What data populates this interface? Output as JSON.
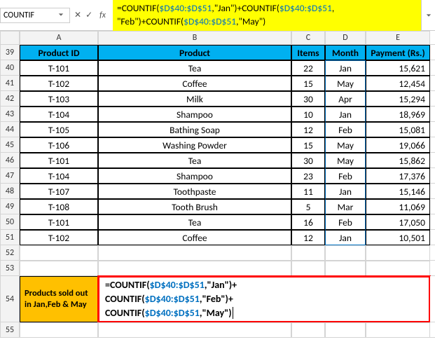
{
  "nameBox": "COUNTIF",
  "formulaBar": {
    "prefix": "=COUNTIF(",
    "ref1": "$D$40:$D$51",
    "mid1": ",\"Jan\")+COUNTIF(",
    "ref2": "$D$40:$D$51",
    "mid2": ", \"Feb\")+COUNTIF(",
    "ref3": "$D$40:$D$51",
    "suffix": ",\"May\")"
  },
  "fx": {
    "cancel": "✕",
    "enter": "✓",
    "label": "fx"
  },
  "cols": [
    "A",
    "B",
    "C",
    "D",
    "E"
  ],
  "headers": {
    "a": "Product ID",
    "b": "Product",
    "c": "Items",
    "d": "Month",
    "e": "Payment (Rs.)"
  },
  "rows": [
    {
      "n": "40",
      "a": "T-101",
      "b": "Tea",
      "c": "22",
      "d": "Jan",
      "e": "15,621"
    },
    {
      "n": "41",
      "a": "T-102",
      "b": "Coffee",
      "c": "15",
      "d": "May",
      "e": "12,454"
    },
    {
      "n": "42",
      "a": "T-103",
      "b": "Milk",
      "c": "30",
      "d": "Apr",
      "e": "15,294"
    },
    {
      "n": "43",
      "a": "T-104",
      "b": "Shampoo",
      "c": "10",
      "d": "Jan",
      "e": "18,969"
    },
    {
      "n": "44",
      "a": "T-105",
      "b": "Bathing Soap",
      "c": "12",
      "d": "Feb",
      "e": "15,081"
    },
    {
      "n": "45",
      "a": "T-106",
      "b": "Washing Powder",
      "c": "15",
      "d": "May",
      "e": "19,066"
    },
    {
      "n": "46",
      "a": "T-101",
      "b": "Tea",
      "c": "30",
      "d": "May",
      "e": "15,862"
    },
    {
      "n": "47",
      "a": "T-104",
      "b": "Shampoo",
      "c": "23",
      "d": "Feb",
      "e": "17,376"
    },
    {
      "n": "48",
      "a": "T-107",
      "b": "Toothpaste",
      "c": "11",
      "d": "Jan",
      "e": "15,146"
    },
    {
      "n": "49",
      "a": "T-108",
      "b": "Tooth Brush",
      "c": "5",
      "d": "Mar",
      "e": "11,069"
    },
    {
      "n": "50",
      "a": "T-101",
      "b": "Tea",
      "c": "16",
      "d": "Feb",
      "e": "17,050"
    },
    {
      "n": "51",
      "a": "T-102",
      "b": "Coffee",
      "c": "12",
      "d": "Jan",
      "e": "10,501"
    }
  ],
  "blankRows": [
    "52",
    "53"
  ],
  "row54": {
    "n": "54",
    "label": "Products sold out in Jan,Feb & May",
    "formula": {
      "l1a": "=COUNTIF(",
      "l1ref": "$D$40:$D$51",
      "l1b": ",\"Jan\")+",
      "l2a": "COUNTIF(",
      "l2ref": "$D$40:$D$51",
      "l2b": ",\"Feb\")+",
      "l3a": "COUNTIF(",
      "l3ref": "$D$40:$D$51",
      "l3b": ",\"May\")"
    }
  },
  "row55": "55"
}
